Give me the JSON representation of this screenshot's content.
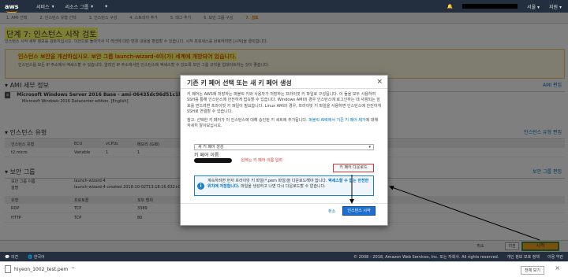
{
  "topnav": {
    "logo": "aws",
    "services": "서비스",
    "resource_groups": "리소스 그룹",
    "region": "서울",
    "support": "지원"
  },
  "steps": [
    {
      "label": "1. AMI 선택"
    },
    {
      "label": "2. 인스턴스 유형 선택"
    },
    {
      "label": "3. 인스턴스 구성"
    },
    {
      "label": "4. 스토리지 추가"
    },
    {
      "label": "5. 태그 추가"
    },
    {
      "label": "6. 보안 그룹 구성"
    },
    {
      "label": "7. 검토",
      "active": true
    }
  ],
  "page": {
    "title": "단계 7: 인스턴스 시작 검토",
    "subtitle": "인스턴스 시작 세부 정보를 검토하십시오. 이전으로 돌아가서 각 섹션에 대한 변경 내용을 편집할 수 있습니다. 시작 프로세스를 완료하려면 [시작]을 클릭합니다.",
    "warning_title": "인스턴스 보안을 개선하십시오. 보안 그룹 launch-wizard-4이(가) 세계에 개방되어 있습니다.",
    "warning_body": "인스턴스를 모든 IP 주소에서 액세스할 수 있습니다. 알려진 IP 주소에서만 인스턴스에 액세스할 수 있도록 보안 그룹 규칙을 업데이트하는 것이 좋습니다.",
    "ami_section": "AMI 세부 정보",
    "ami_edit": "AMI 편집",
    "ami_name": "Microsoft Windows Server 2016 Base - ami-06435dc96d51c1b50",
    "ami_desc": "Microsoft Windows 2016 Datacenter edition. [English]",
    "instance_section": "인스턴스 유형",
    "instance_edit": "인스턴스 유형 편집",
    "instance_headers": [
      "인스턴스 유형",
      "ECU",
      "vCPUs",
      "메모리 (GiB)"
    ],
    "instance_row": [
      "t2.micro",
      "Variable",
      "1",
      "1"
    ],
    "sg_section": "보안 그룹",
    "sg_edit": "보안 그룹 편집",
    "sg_name_label": "보안 그룹 이름",
    "sg_name": "launch-wizard-4",
    "sg_desc_label": "설명",
    "sg_desc": "launch-wizard-4 created 2018-10-02T13:18:16.632+09:00",
    "rules_headers": [
      "유형",
      "프로토콜",
      "포트 범위"
    ],
    "rules": [
      [
        "RDP",
        "TCP",
        "3389"
      ],
      [
        "HTTP",
        "TCP",
        "80"
      ]
    ]
  },
  "bottombar": {
    "cancel": "취소",
    "prev": "이전",
    "launch": "시작"
  },
  "footer": {
    "feedback": "의견",
    "language": "한국어",
    "copyright": "© 2008 - 2018, Amazon Web Services, Inc. 또는 자회사. All rights reserved.",
    "privacy": "개인 정보 보호 정책",
    "terms": "이용 약관"
  },
  "downloadbar": {
    "file": "hiyeon_1002_test.pem",
    "show_all": "전체 보기"
  },
  "modal": {
    "title": "기존 키 페어 선택 또는 새 키 페어 생성",
    "body1": "키 페어는 AWS에 저장하는 퍼블릭 키와 사용자가 저장하는 프라이빗 키 파일로 구성됩니다. 이 둘을 모두 사용하여 SSH를 통해 인스턴스에 안전하게 접속할 수 있습니다. Windows AMI의 경우 인스턴스에 로그인하는 데 사용되는 암호를 얻으려면 프라이빗 키 파일이 필요합니다. Linux AMI의 경우, 프라이빗 키 파일을 사용하면 인스턴스에 안전하게 SSH로 연결할 수 있습니다.",
    "body2_prefix": "참고: 선택한 키 페어가 이 인스턴스에 대해 승인된 키 세트에 추가됩니다.",
    "body2_link": "퍼블릭 AMI에서 기존 키 페어 제거",
    "body2_suffix": "에 대해 자세히 알아보십시오.",
    "select_value": "새 키 페어 생성",
    "keypair_label": "키 페어 이름",
    "keypair_hint": "원하는 키 페어 이름 입력",
    "download_button": "키 페어 다운로드",
    "info_prefix": "계속하려면 먼저 프라이빗 키 파일",
    "info_file": "(*.pem 파일)",
    "info_mid": "을 다운로드해야 합니다.",
    "info_bold": "액세스할 수 없는 안전한 위치에 저장합니다.",
    "info_suffix": "파일을 생성하고 나면 다시 다운로드할 수 없습니다.",
    "cancel": "취소",
    "launch": "인스턴스 시작"
  }
}
